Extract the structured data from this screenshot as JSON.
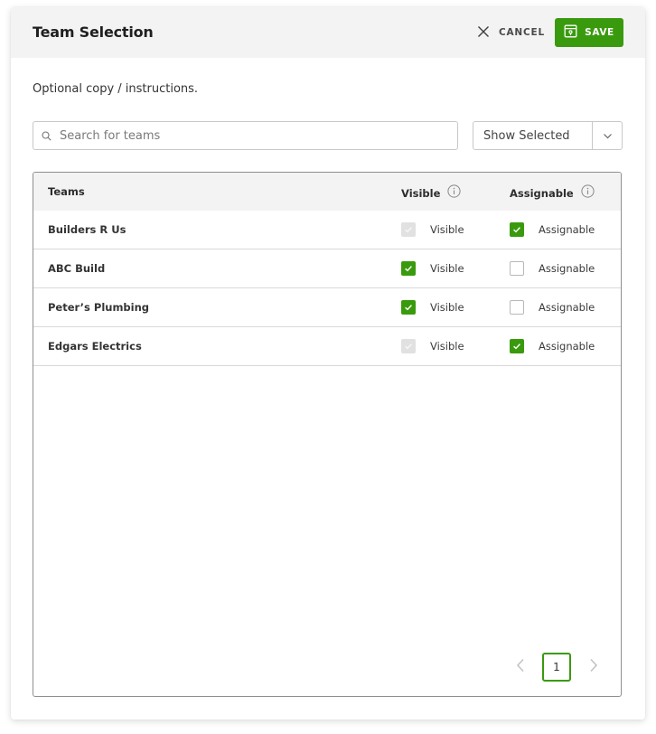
{
  "header": {
    "title": "Team Selection",
    "cancel_label": "CANCEL",
    "cancel_icon": "close-icon",
    "save_label": "SAVE",
    "save_icon": "save-icon"
  },
  "instructions": "Optional copy / instructions.",
  "search": {
    "placeholder": "Search for teams",
    "value": "",
    "icon": "search-icon"
  },
  "filter": {
    "selected": "Show Selected",
    "icon": "chevron-down-icon"
  },
  "table": {
    "columns": {
      "teams": "Teams",
      "visible": "Visible",
      "assignable": "Assignable"
    },
    "info_icon": "info-icon",
    "rows": [
      {
        "team": "Builders R Us",
        "visible_label": "Visible",
        "visible_state": "disabled-checked",
        "assignable_label": "Assignable",
        "assignable_state": "checked"
      },
      {
        "team": "ABC Build",
        "visible_label": "Visible",
        "visible_state": "checked",
        "assignable_label": "Assignable",
        "assignable_state": "unchecked"
      },
      {
        "team": "Peter’s Plumbing",
        "visible_label": "Visible",
        "visible_state": "checked",
        "assignable_label": "Assignable",
        "assignable_state": "unchecked"
      },
      {
        "team": "Edgars Electrics",
        "visible_label": "Visible",
        "visible_state": "disabled-checked",
        "assignable_label": "Assignable",
        "assignable_state": "checked"
      }
    ]
  },
  "pagination": {
    "current_page": "1",
    "prev_icon": "chevron-left-icon",
    "next_icon": "chevron-right-icon"
  },
  "colors": {
    "accent": "#3a9a0e",
    "header_bg": "#f3f3f3",
    "disabled_checkbox": "#e1e1e1"
  }
}
